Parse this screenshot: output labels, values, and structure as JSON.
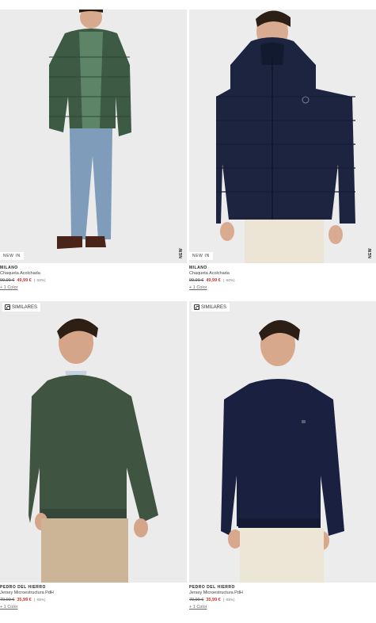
{
  "products": [
    {
      "brand": "MILANO",
      "name": "Chaqueta Acolchada",
      "old_price": "99,99 €",
      "new_price": "49,99 €",
      "discount": "( -50%)",
      "colors": "+ 1 Color",
      "badge": "NEW IN",
      "vertical_tag": "NEW",
      "garment_color": "#3d5a44"
    },
    {
      "brand": "MILANO",
      "name": "Chaqueta Acolchada",
      "old_price": "99,99 €",
      "new_price": "49,99 €",
      "discount": "( -50%)",
      "colors": "+ 1 Color",
      "badge": "NEW IN",
      "vertical_tag": "NEW",
      "garment_color": "#1c2440"
    },
    {
      "brand": "PEDRO DEL HIERRO",
      "name": "Jersey Microestructura PdH",
      "old_price": "79,99 €",
      "new_price": "35,99 €",
      "discount": "( -55%)",
      "colors": "+ 1 Color",
      "similar_label": "SIMILARES",
      "garment_color": "#3f5441"
    },
    {
      "brand": "PEDRO DEL HIERRO",
      "name": "Jersey Microestructura PdH",
      "old_price": "79,99 €",
      "new_price": "35,99 €",
      "discount": "( -55%)",
      "colors": "+ 1 Color",
      "similar_label": "SIMILARES",
      "garment_color": "#1a2140"
    }
  ]
}
